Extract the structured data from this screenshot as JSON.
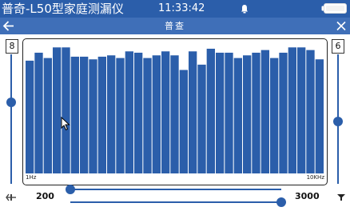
{
  "status": {
    "app_title": "普奇-L50型家庭测漏仪",
    "time": "11:33:42"
  },
  "toolbar": {
    "title": "普查"
  },
  "left_gain": {
    "value": "8",
    "level": 0.37
  },
  "right_volume": {
    "value": "6",
    "level": 0.52
  },
  "spectrum": {
    "freq_min_label": "1Hz",
    "freq_max_label": "10KHz",
    "bar_color": "#2b5eaa",
    "bars": [
      0.85,
      0.91,
      0.87,
      0.95,
      0.95,
      0.88,
      0.88,
      0.86,
      0.88,
      0.89,
      0.87,
      0.92,
      0.91,
      0.87,
      0.89,
      0.92,
      0.89,
      0.78,
      0.92,
      0.82,
      0.94,
      0.91,
      0.91,
      0.87,
      0.89,
      0.91,
      0.93,
      0.87,
      0.91,
      0.95,
      0.95,
      0.93,
      0.86
    ]
  },
  "range": {
    "low_label": "200",
    "high_label": "3000",
    "low_level": 0.0,
    "high_level": 1.0
  },
  "icons": {
    "status": [
      "alarm-icon",
      "battery-icon"
    ],
    "toolbar": [
      "back-icon",
      "close-icon"
    ],
    "bottom": [
      "filter-icon",
      "speaker-icon"
    ]
  }
}
